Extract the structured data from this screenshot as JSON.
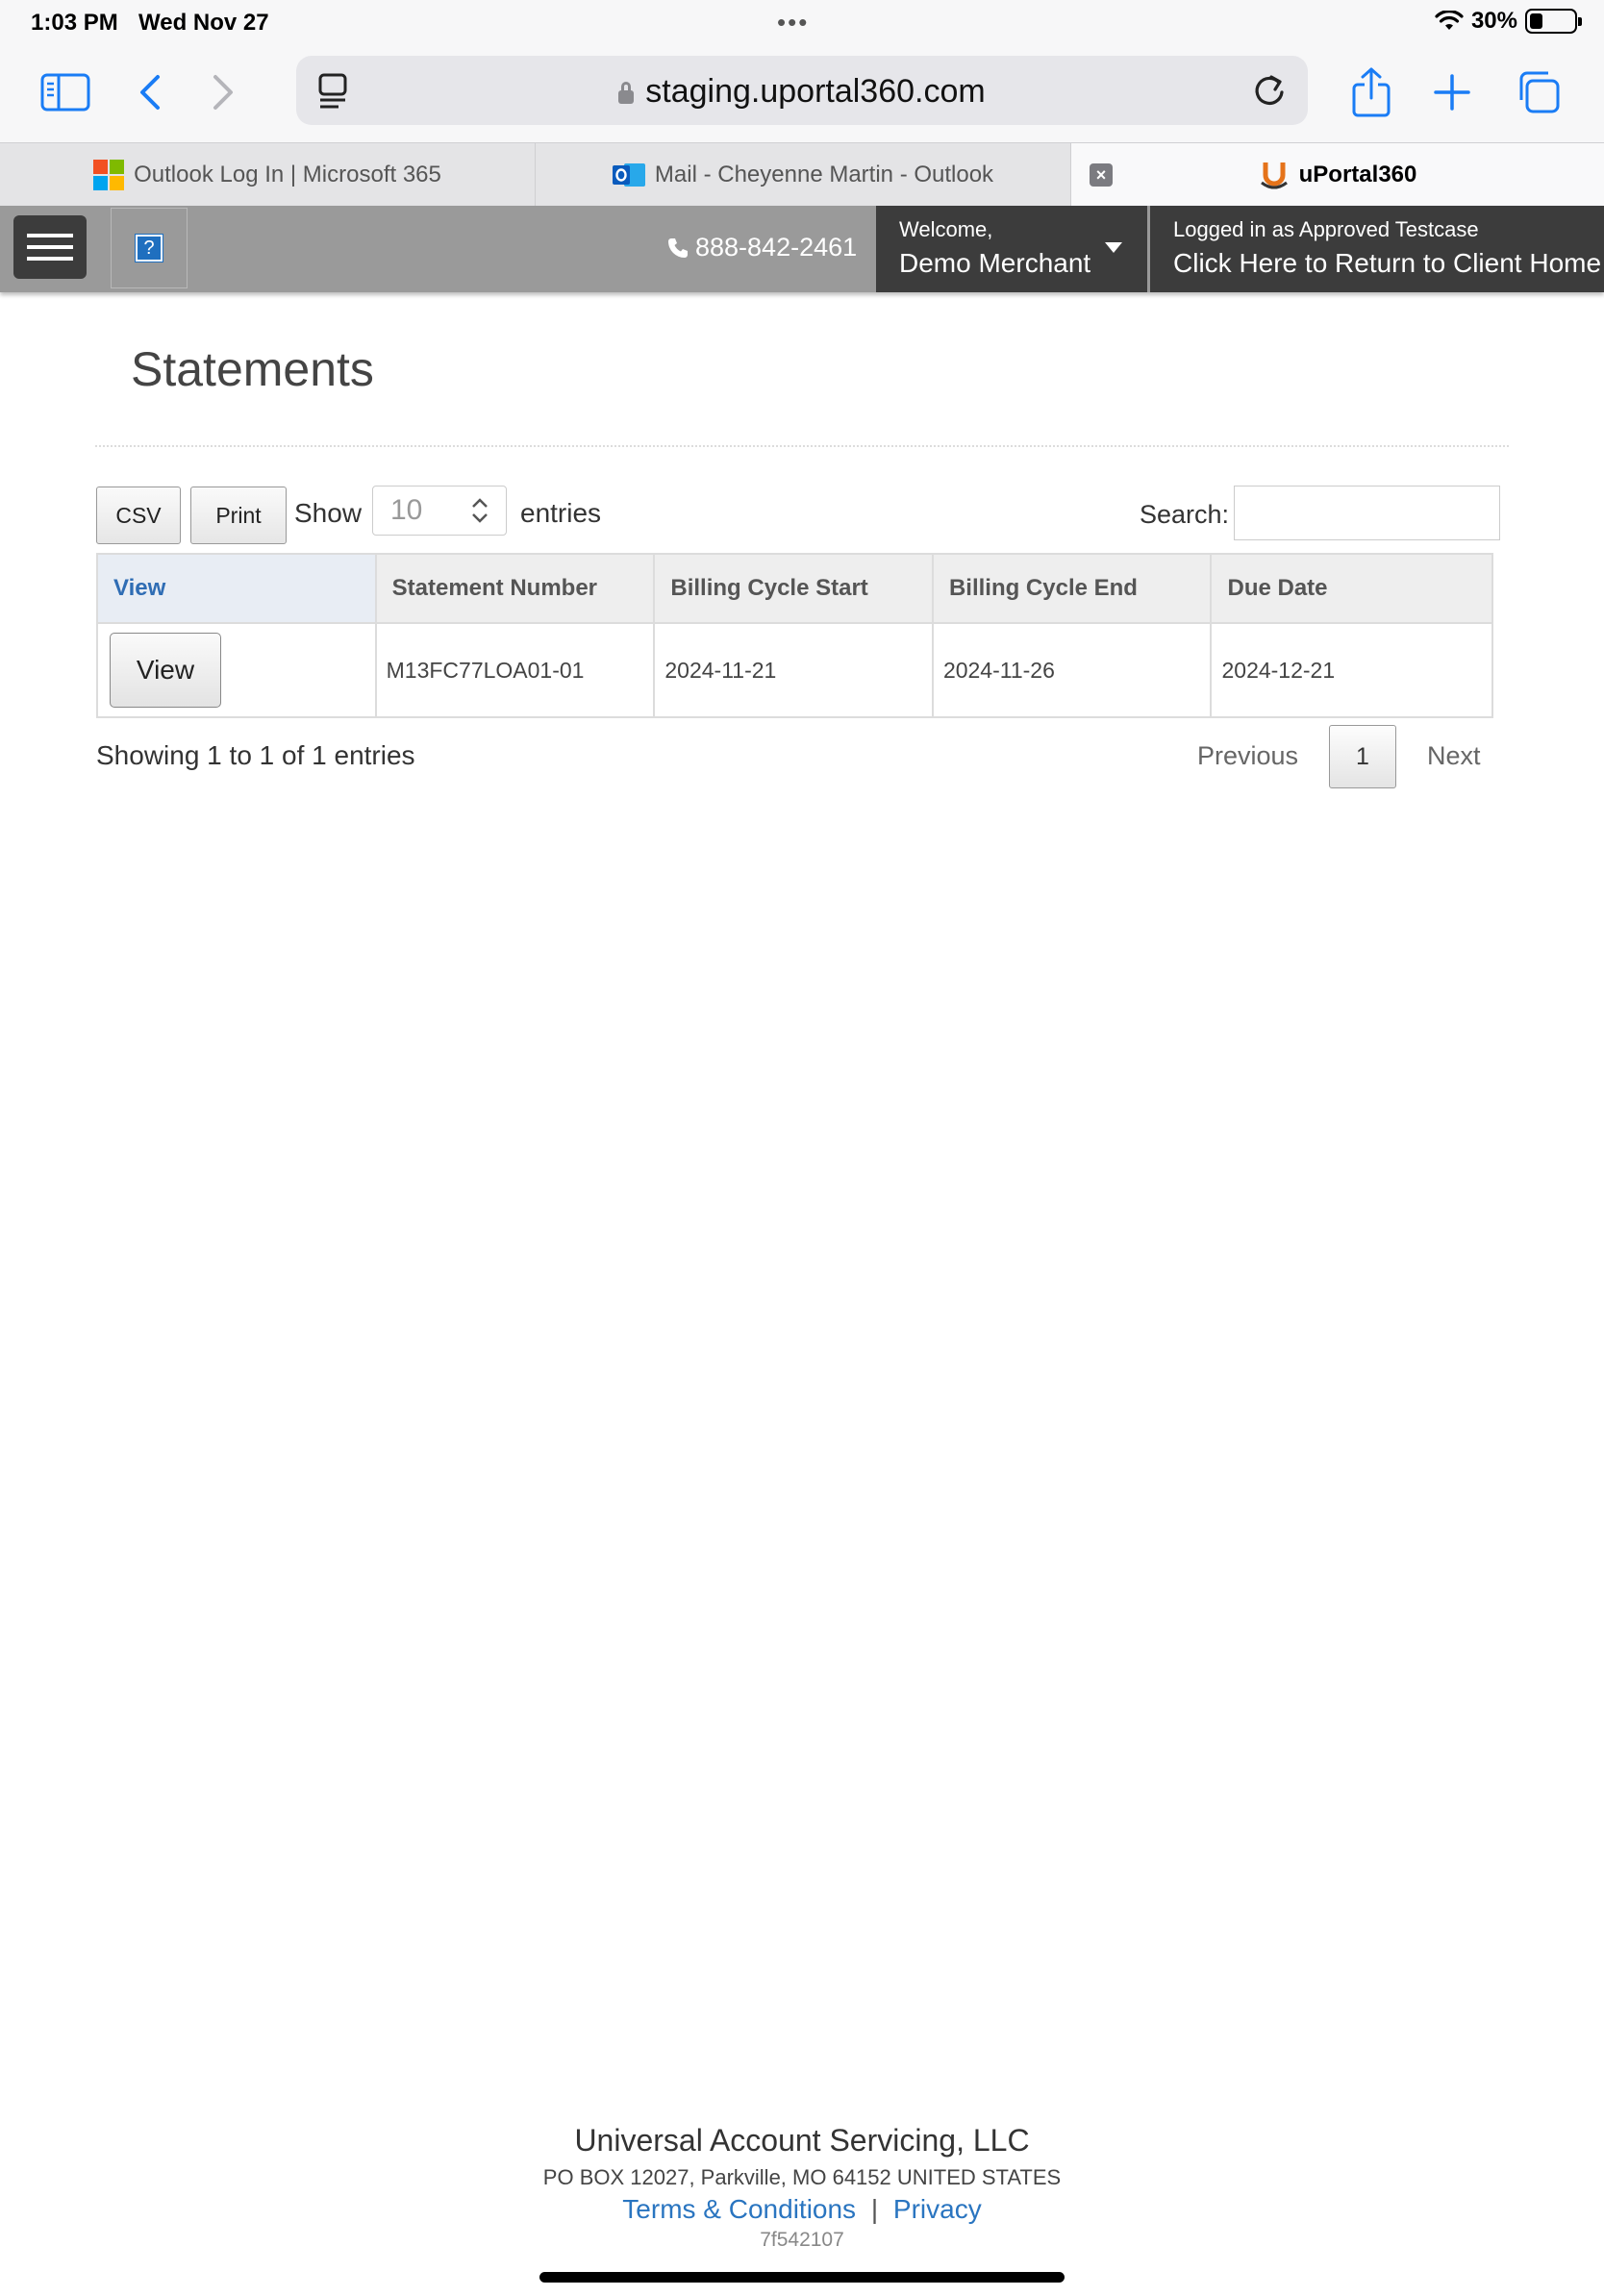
{
  "status_bar": {
    "time": "1:03 PM",
    "date": "Wed Nov 27",
    "battery_text": "30%",
    "battery_level": 0.3
  },
  "browser": {
    "url": "staging.uportal360.com",
    "icons": [
      "sidebar-icon",
      "back-icon",
      "forward-icon",
      "reader-icon",
      "reload-icon",
      "share-icon",
      "plus-icon",
      "tabs-icon"
    ],
    "accent_color": "#1a7cf5",
    "tabs": [
      {
        "label": "Outlook Log In | Microsoft 365",
        "icon": "microsoft-logo-icon"
      },
      {
        "label": "Mail - Cheyenne Martin - Outlook",
        "icon": "outlook-logo-icon"
      },
      {
        "label": "uPortal360",
        "icon": "uportal-logo-icon",
        "active": true
      }
    ]
  },
  "app_header": {
    "phone": "888-842-2461",
    "help_icon": "?",
    "welcome_line1": "Welcome,",
    "welcome_line2": "Demo Merchant",
    "logged_line1": "Logged in as Approved Testcase",
    "logged_line2": "Click Here to Return to Client Home",
    "header_color": "#9a9a9a",
    "dark_color": "#3c3c3c"
  },
  "page": {
    "title": "Statements",
    "buttons": {
      "csv": "CSV",
      "print": "Print"
    },
    "show_label": "Show",
    "entries_label": "entries",
    "page_length": "10",
    "search_label": "Search:",
    "search_value": ""
  },
  "table": {
    "headers": [
      "View",
      "Statement Number",
      "Billing Cycle Start",
      "Billing Cycle End",
      "Due Date"
    ],
    "rows": [
      {
        "view": "View",
        "statement_number": "M13FC77LOA01-01",
        "cycle_start": "2024-11-21",
        "cycle_end": "2024-11-26",
        "due_date": "2024-12-21"
      }
    ]
  },
  "pagination": {
    "info": "Showing 1 to 1 of 1 entries",
    "previous": "Previous",
    "current": "1",
    "next": "Next"
  },
  "footer": {
    "company": "Universal Account Servicing, LLC",
    "address": "PO BOX 12027, Parkville, MO 64152 UNITED STATES",
    "terms": "Terms & Conditions",
    "separator": "|",
    "privacy": "Privacy",
    "build": "7f542107"
  }
}
